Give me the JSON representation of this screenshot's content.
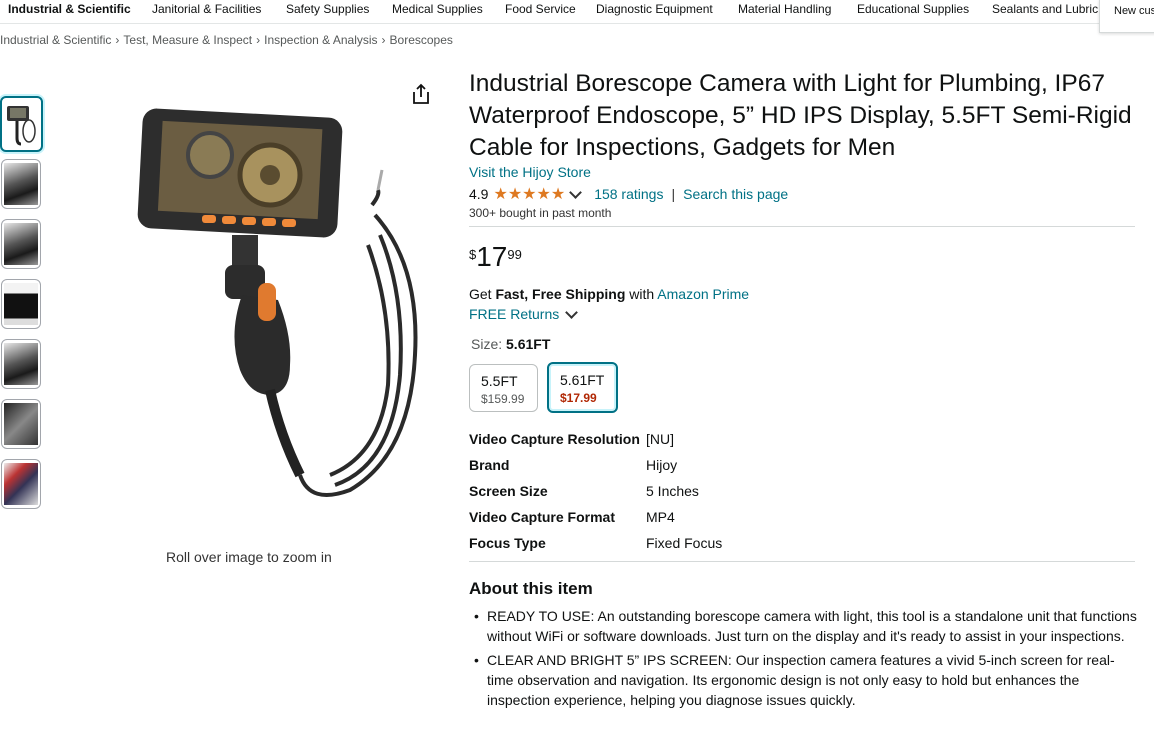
{
  "catnav": {
    "items": [
      "Industrial & Scientific",
      "Janitorial & Facilities",
      "Safety Supplies",
      "Medical Supplies",
      "Food Service",
      "Diagnostic Equipment",
      "Material Handling",
      "Educational Supplies",
      "Sealants and Lubric"
    ]
  },
  "popover": {
    "text": "New cus"
  },
  "breadcrumb": {
    "items": [
      "Industrial & Scientific",
      "Test, Measure & Inspect",
      "Inspection & Analysis",
      "Borescopes"
    ],
    "separator": "›"
  },
  "gallery": {
    "zoom_hint": "Roll over image to zoom in",
    "thumbnail_count": 7
  },
  "product": {
    "title": "Industrial Borescope Camera with Light for Plumbing, IP67 Waterproof Endoscope, 5” HD IPS Display, 5.5FT Semi-Rigid Cable for Inspections, Gadgets for Men",
    "store_link": "Visit the Hijoy Store",
    "rating": "4.9",
    "rating_stars": 4.9,
    "ratings_count": "158 ratings",
    "search_link": "Search this page",
    "bought": "300+ bought in past month",
    "price": {
      "symbol": "$",
      "whole": "17",
      "fraction": "99"
    },
    "shipping": {
      "prefix": "Get ",
      "bold": "Fast, Free Shipping",
      "middle": " with ",
      "link": "Amazon Prime"
    },
    "returns": "FREE Returns",
    "size": {
      "label": "Size: ",
      "selected": "5.61FT",
      "options": [
        {
          "name": "5.5FT",
          "price": "$159.99"
        },
        {
          "name": "5.61FT",
          "price": "$17.99"
        }
      ]
    },
    "specs": [
      {
        "key": "Video Capture Resolution",
        "value": "[NU]"
      },
      {
        "key": "Brand",
        "value": "Hijoy"
      },
      {
        "key": "Screen Size",
        "value": "5 Inches"
      },
      {
        "key": "Video Capture Format",
        "value": "MP4"
      },
      {
        "key": "Focus Type",
        "value": "Fixed Focus"
      }
    ],
    "about_title": "About this item",
    "bullets": [
      "READY TO USE: An outstanding borescope camera with light, this tool is a standalone unit that functions without WiFi or software downloads. Just turn on the display and it's ready to assist in your inspections.",
      "CLEAR AND BRIGHT 5” IPS SCREEN: Our inspection camera features a vivid 5-inch screen for real-time observation and navigation. Its ergonomic design is not only easy to hold but enhances the inspection experience, helping you diagnose issues quickly."
    ]
  },
  "colors": {
    "link": "#007185",
    "star": "#de7921",
    "price_red": "#b12704"
  }
}
